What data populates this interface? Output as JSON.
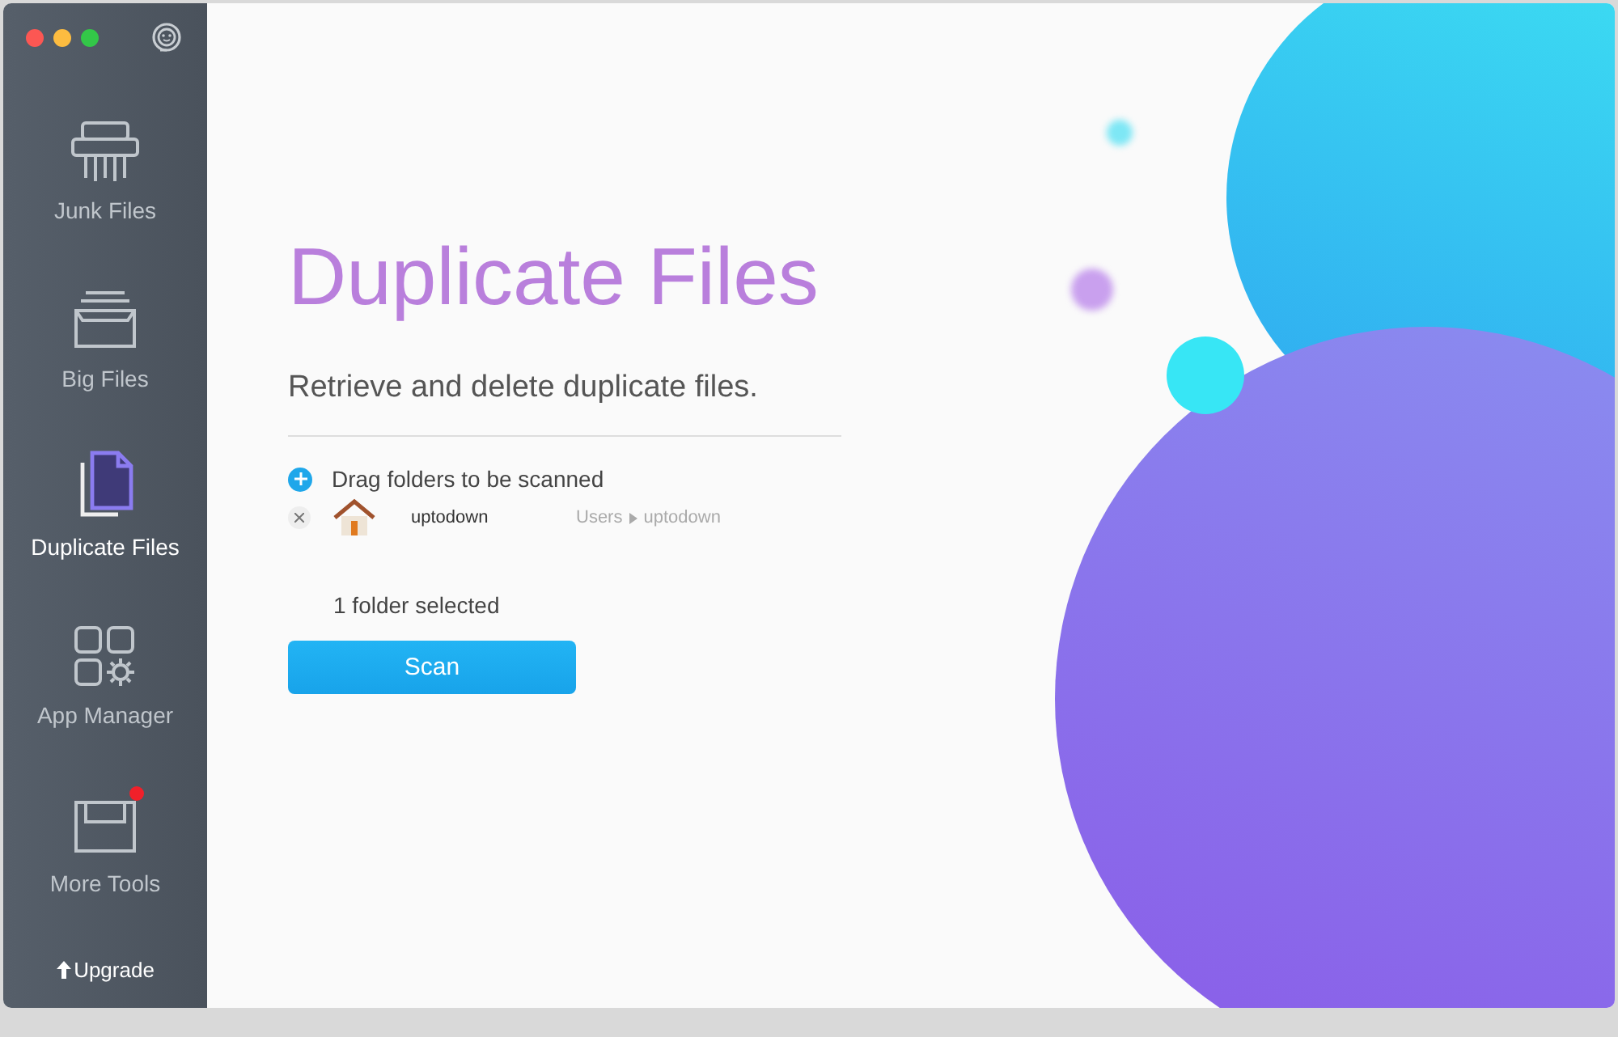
{
  "sidebar": {
    "items": [
      {
        "label": "Junk Files",
        "selected": false,
        "notification": false
      },
      {
        "label": "Big Files",
        "selected": false,
        "notification": false
      },
      {
        "label": "Duplicate Files",
        "selected": true,
        "notification": false
      },
      {
        "label": "App Manager",
        "selected": false,
        "notification": false
      },
      {
        "label": "More Tools",
        "selected": false,
        "notification": true
      }
    ],
    "upgrade": "Upgrade"
  },
  "main": {
    "title": "Duplicate Files",
    "subtitle": "Retrieve and delete duplicate files.",
    "add_label": "Drag folders to be scanned",
    "folders": [
      {
        "name": "uptodown",
        "path": [
          "Users",
          "uptodown"
        ]
      }
    ],
    "selected_count": "1 folder selected",
    "scan_button": "Scan"
  }
}
